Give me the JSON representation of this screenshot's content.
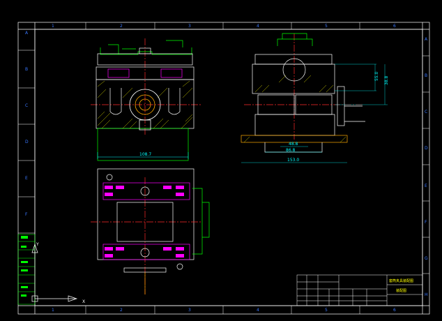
{
  "colors": {
    "background": "#000000",
    "frame": "#ffffff",
    "zone_text": "#3a78ff",
    "outline": "#ffffff",
    "hidden": "#4a70ff",
    "green": "#00ff00",
    "red": "#ff2a2a",
    "magenta": "#ff00ff",
    "cyan": "#00ffff",
    "yellow": "#ffff00",
    "hatch": "#c8c800"
  },
  "border": {
    "top_zones": [
      "1",
      "2",
      "3",
      "4",
      "5",
      "6"
    ],
    "bottom_zones": [
      "1",
      "2",
      "3",
      "4",
      "5",
      "6"
    ],
    "left_zones": [
      "A",
      "B",
      "C",
      "D",
      "E",
      "F"
    ],
    "right_zones": [
      "A",
      "B",
      "C",
      "D",
      "E",
      "F",
      "G",
      "H"
    ]
  },
  "dimensions": {
    "front_width": "108.7",
    "side_height_1": "55.0",
    "side_height_2": "38.8",
    "slot_inner": "48.8",
    "slot_outer": "86.8",
    "base_width": "153.0"
  },
  "title_block": {
    "drawing_name": "套筒夹具装配图",
    "drawing_subtitle": "装配图"
  },
  "ucs_icon": {
    "x_label": "X",
    "y_label": "Y"
  }
}
